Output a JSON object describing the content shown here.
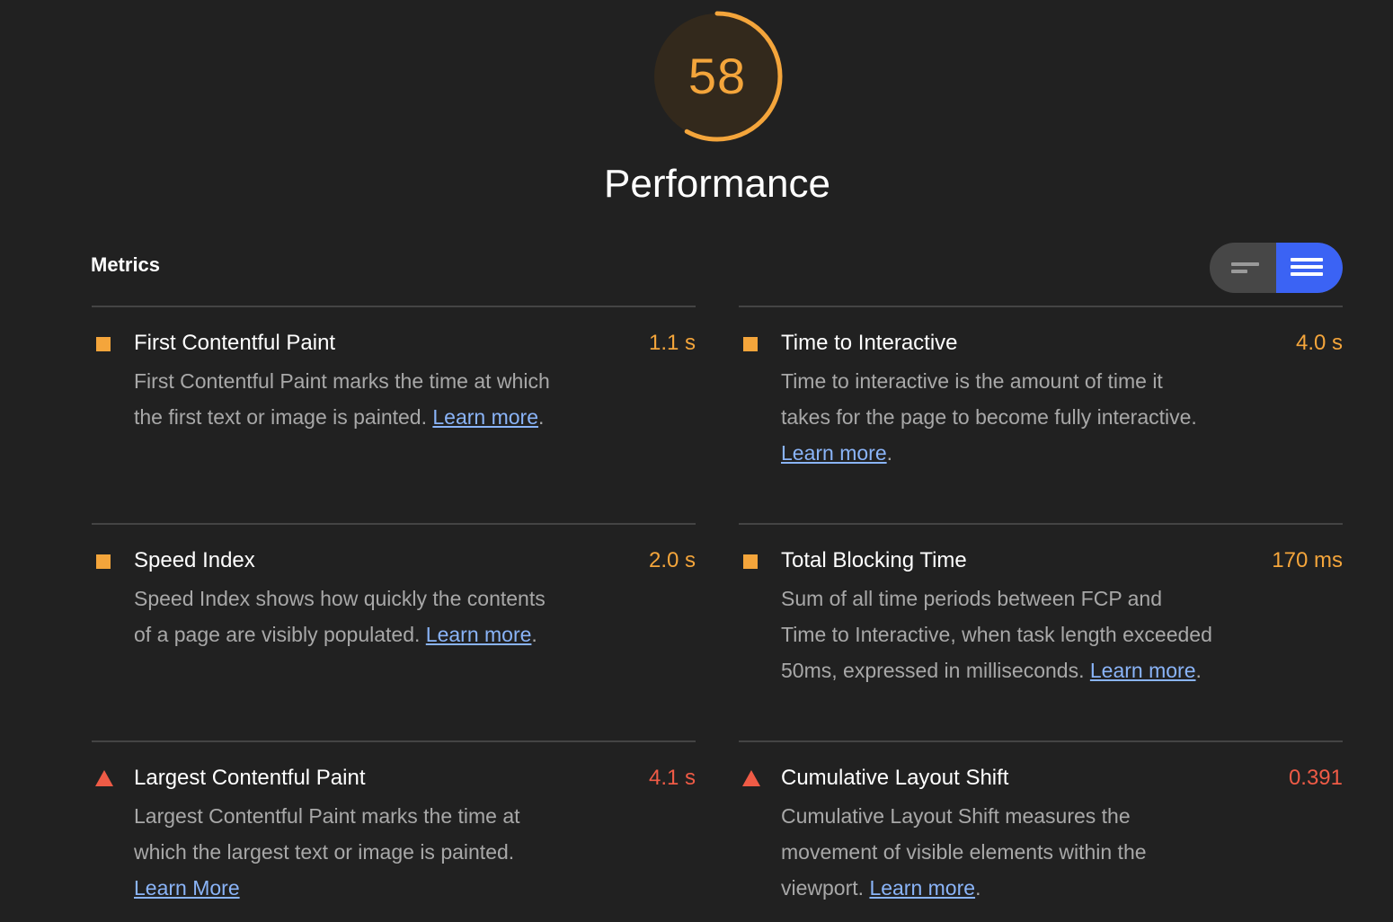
{
  "score": {
    "value": "58",
    "fraction": 0.58,
    "color": "#f4a53b"
  },
  "category": {
    "title": "Performance"
  },
  "metrics_section": {
    "header": "Metrics",
    "toggle": {
      "compact_icon": "lines-short-icon",
      "expanded_icon": "lines-long-icon",
      "active": "expanded",
      "active_color": "#3b63f4"
    }
  },
  "metrics": [
    {
      "title": "First Contentful Paint",
      "value": "1.1 s",
      "status": "average",
      "marker": "square",
      "description": "First Contentful Paint marks the time at which the first text or image is painted.",
      "link": "Learn more",
      "suffix": "."
    },
    {
      "title": "Time to Interactive",
      "value": "4.0 s",
      "status": "average",
      "marker": "square",
      "description": "Time to interactive is the amount of time it takes for the page to become fully interactive.",
      "link": "Learn more",
      "suffix": "."
    },
    {
      "title": "Speed Index",
      "value": "2.0 s",
      "status": "average",
      "marker": "square",
      "description": "Speed Index shows how quickly the contents of a page are visibly populated.",
      "link": "Learn more",
      "suffix": "."
    },
    {
      "title": "Total Blocking Time",
      "value": "170 ms",
      "status": "average",
      "marker": "square",
      "description": "Sum of all time periods between FCP and Time to Interactive, when task length exceeded 50ms, expressed in milliseconds.",
      "link": "Learn more",
      "suffix": "."
    },
    {
      "title": "Largest Contentful Paint",
      "value": "4.1 s",
      "status": "fail",
      "marker": "triangle",
      "description": "Largest Contentful Paint marks the time at which the largest text or image is painted.",
      "link": "Learn More",
      "suffix": ""
    },
    {
      "title": "Cumulative Layout Shift",
      "value": "0.391",
      "status": "fail",
      "marker": "triangle",
      "description": "Cumulative Layout Shift measures the movement of visible elements within the viewport.",
      "link": "Learn more",
      "suffix": "."
    }
  ],
  "colors": {
    "average": "#f4a53b",
    "fail": "#ef5b46",
    "link": "#8ab4f8",
    "background": "#212121"
  }
}
